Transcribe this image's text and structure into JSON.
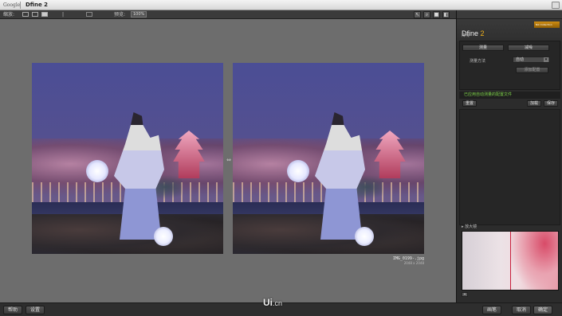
{
  "titlebar": {
    "google": "Google",
    "app_title": "Dfine 2"
  },
  "toolbar": {
    "zoom_label": "缩放:",
    "preview_label": "预览:",
    "preview_value": "100%"
  },
  "canvas": {
    "file_name": "IMG_0199-.jpg",
    "file_dims": "2048 x 2048"
  },
  "panel": {
    "brand_name": "Dfine",
    "brand_num": "2",
    "badge": "Nik Collection",
    "section": "降噪",
    "btn_measure": "测量",
    "btn_reduce": "减噪",
    "method_label": "测量方法",
    "method_value": "自动",
    "btn_profile": "添加配置",
    "status": "已应用自动测量的配置文件",
    "btn_reset": "重置",
    "btn_load": "加载",
    "btn_save": "保存",
    "loupe_title": "放大镜"
  },
  "bottombar": {
    "help": "帮助",
    "settings": "设置",
    "brush": "画笔",
    "cancel": "取消",
    "ok": "确定"
  },
  "watermark": {
    "main": "Ui",
    "suffix": ".cn"
  }
}
